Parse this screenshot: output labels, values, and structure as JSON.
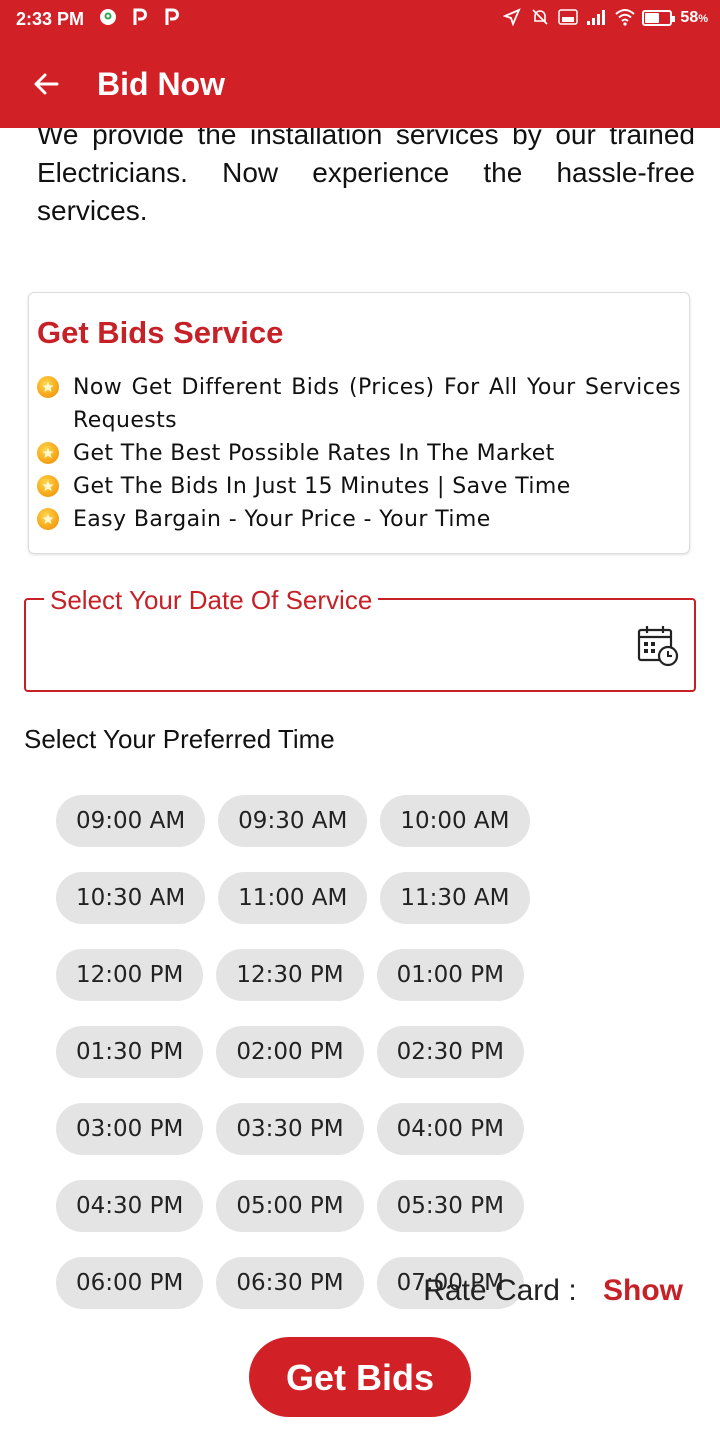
{
  "status_bar": {
    "time": "2:33 PM",
    "left_icons": [
      "maps-pin-icon",
      "p-icon",
      "p-icon"
    ],
    "right_icons": [
      "location-arrow-icon",
      "mute-bell-icon",
      "volte-icon",
      "signal-icon",
      "wifi-icon"
    ],
    "battery_percent_text": "58",
    "battery_percent_suffix": "%",
    "battery_level": 0.58
  },
  "app_bar": {
    "back_icon": "arrow-left-icon",
    "title": "Bid Now",
    "color": "#d12127"
  },
  "intro_text": "We provide the installation services by our trained Electricians. Now experience the hassle-free services.",
  "bids_card": {
    "title": "Get Bids Service",
    "bullet_icon": "star-coin-icon",
    "items": [
      "Now Get Different Bids (Prices) For All Your Services Requests",
      "Get The Best Possible Rates In The Market",
      "Get The Bids In Just 15 Minutes | Save Time",
      "Easy Bargain - Your Price - Your Time"
    ]
  },
  "date_field": {
    "label": "Select Your Date Of Service",
    "value": "",
    "icon": "calendar-clock-icon"
  },
  "time_section": {
    "heading": "Select Your Preferred Time",
    "slots": [
      "09:00 AM",
      "09:30 AM",
      "10:00 AM",
      "10:30 AM",
      "11:00 AM",
      "11:30 AM",
      "12:00 PM",
      "12:30 PM",
      "01:00 PM",
      "01:30 PM",
      "02:00 PM",
      "02:30 PM",
      "03:00 PM",
      "03:30 PM",
      "04:00 PM",
      "04:30 PM",
      "05:00 PM",
      "05:30 PM",
      "06:00 PM",
      "06:30 PM",
      "07:00 PM"
    ]
  },
  "rate_card": {
    "label": "Rate Card :",
    "link": "Show"
  },
  "submit_button": "Get Bids",
  "colors": {
    "brand_red": "#d12127",
    "accent_red": "#c62127",
    "chip_bg": "#e4e4e4"
  }
}
